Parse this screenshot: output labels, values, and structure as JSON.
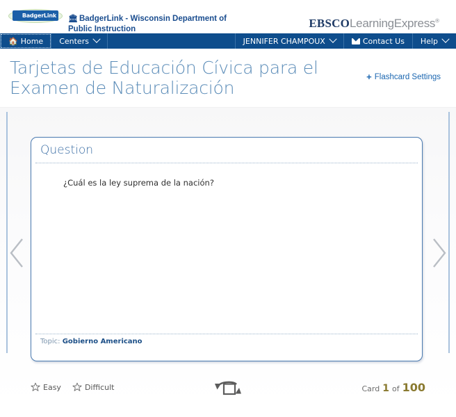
{
  "header": {
    "logo_alt": "BadgerLink",
    "logo_text": "BadgerLink",
    "site_title": "BadgerLink - Wisconsin Department of Public Instruction",
    "brand_primary": "EBSCO",
    "brand_secondary": "LearningExpress",
    "brand_reg": "®"
  },
  "nav": {
    "left_items": [
      {
        "label": "Home",
        "icon": "home-icon",
        "has_caret": false,
        "focused": true
      },
      {
        "label": "Centers",
        "icon": "",
        "has_caret": true,
        "focused": false
      }
    ],
    "right_items": [
      {
        "label": "JENNIFER CHAMPOUX",
        "icon": "",
        "has_caret": true
      },
      {
        "label": "Contact Us",
        "icon": "mail-icon",
        "has_caret": false
      },
      {
        "label": "Help",
        "icon": "",
        "has_caret": true
      }
    ]
  },
  "page": {
    "title": "Tarjetas de Educación Cívica para el Examen de Naturalización",
    "settings_link": "Flashcard Settings",
    "settings_plus": "+"
  },
  "flashcard": {
    "side_label": "Question",
    "question": "¿Cuál es la ley suprema de la nación?",
    "topic_label": "Topic:",
    "topic_value": "Gobierno Americano"
  },
  "controls": {
    "easy_label": "Easy",
    "difficult_label": "Difficult",
    "flip_label": "flip-card",
    "counter_prefix": "Card",
    "counter_current": "1",
    "counter_middle": "of",
    "counter_total": "100"
  },
  "nav_arrows": {
    "prev": "previous-card",
    "next": "next-card"
  },
  "colors": {
    "navbar": "#0e4d8c",
    "title": "#5b8cb8",
    "link": "#1a66b0",
    "card_border": "#4a7ab0",
    "counter_accent": "#8a7a30"
  }
}
